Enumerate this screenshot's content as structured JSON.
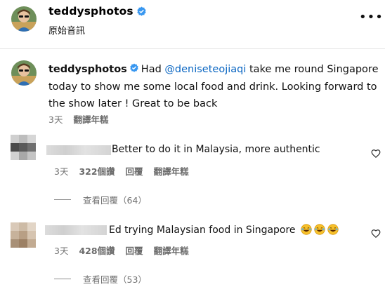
{
  "header": {
    "username": "teddysphotos",
    "subtitle": "原始音訊",
    "more_icon": "more-horizontal-icon"
  },
  "caption": {
    "username": "teddysphotos",
    "text_before": "Had ",
    "mention": "@deniseteojiaqi",
    "text_after": " take me round Singapore today to show me some local food and drink. Looking forward to the show later ! Great to be back",
    "time": "3天",
    "translate": "翻譯年糕"
  },
  "comments": [
    {
      "text": "Better to do it in Malaysia, more authentic",
      "time": "3天",
      "likes": "322個讚",
      "reply": "回覆",
      "translate": "翻譯年糕",
      "view_replies": "查看回覆（64）"
    },
    {
      "text": "Ed trying Malaysian food in Singapore",
      "emoji_icon": "laughing-tears-emoji",
      "time": "3天",
      "likes": "428個讚",
      "reply": "回覆",
      "translate": "翻譯年糕",
      "view_replies": "查看回覆（53）"
    }
  ],
  "colors": {
    "verified": "#3897f0",
    "mention": "#0a66c2",
    "muted": "#737373"
  }
}
